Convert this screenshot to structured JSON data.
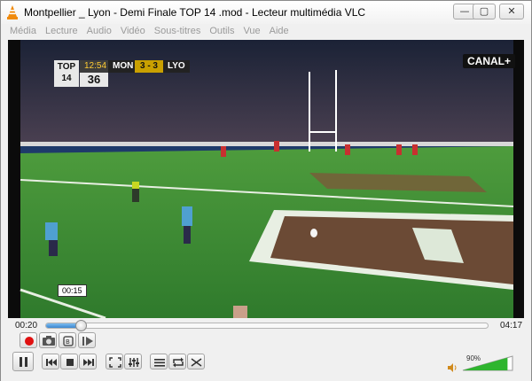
{
  "window": {
    "title": "Montpellier _ Lyon - Demi Finale TOP 14 .mod - Lecteur multimédia VLC",
    "min_glyph": "—",
    "max_glyph": "▢",
    "close_glyph": "✕"
  },
  "menu": [
    "Média",
    "Lecture",
    "Audio",
    "Vidéo",
    "Sous-titres",
    "Outils",
    "Vue",
    "Aide"
  ],
  "video": {
    "scoreboard": {
      "league_logo_top": "TOP",
      "league_logo_bottom": "14",
      "clock": "12:54",
      "home": "MON",
      "score": "3 - 3",
      "away": "LYO",
      "minute": "36"
    },
    "broadcaster_logo": "CANAL+",
    "hover_time": "00:15"
  },
  "playback": {
    "elapsed": "00:20",
    "total": "04:17",
    "progress_fraction": 0.078
  },
  "volume": {
    "level_percent": 90,
    "label": "90%"
  },
  "icons": {
    "app": "vlc-cone-icon",
    "record": "record-icon",
    "snapshot": "camera-icon",
    "loop_ab": "loop-ab-icon",
    "frame_step": "frame-step-icon",
    "pause": "pause-icon",
    "previous": "previous-icon",
    "stop": "stop-icon",
    "next": "next-icon",
    "fullscreen": "fullscreen-icon",
    "extended": "equalizer-icon",
    "playlist": "playlist-icon",
    "loop": "loop-icon",
    "shuffle": "shuffle-icon",
    "speaker": "speaker-icon"
  },
  "colors": {
    "seek_fill": "#3b86cf",
    "volume_fill": "#2fb52f",
    "record": "#e01010",
    "pitch": "#3f8f2f"
  }
}
